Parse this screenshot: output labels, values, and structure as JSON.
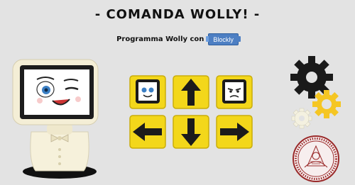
{
  "header": {
    "title": "- COMANDA WOLLY! -",
    "subtitle": "Programma Wolly con",
    "blockly_label": "Blockly"
  },
  "controls": {
    "buttons": [
      {
        "name": "face-happy-button",
        "icon": "happy-face-icon"
      },
      {
        "name": "arrow-up-button",
        "icon": "arrow-up-icon"
      },
      {
        "name": "face-sad-button",
        "icon": "sad-face-icon"
      },
      {
        "name": "arrow-left-button",
        "icon": "arrow-left-icon"
      },
      {
        "name": "arrow-down-button",
        "icon": "arrow-down-icon"
      },
      {
        "name": "arrow-right-button",
        "icon": "arrow-right-icon"
      }
    ]
  },
  "colors": {
    "background": "#e3e3e3",
    "button_yellow": "#f3d71a",
    "button_dark": "#1b1b1b",
    "gear_black": "#1a1a1a",
    "gear_yellow": "#f5c623",
    "gear_white": "#f4f1e0",
    "seal_red": "#9a2a2a",
    "blockly_blue": "#4d7fc3"
  },
  "decor": {
    "robot": "wolly-robot-illustration",
    "gears": "gears-illustration",
    "seal": "university-seal-logo"
  }
}
